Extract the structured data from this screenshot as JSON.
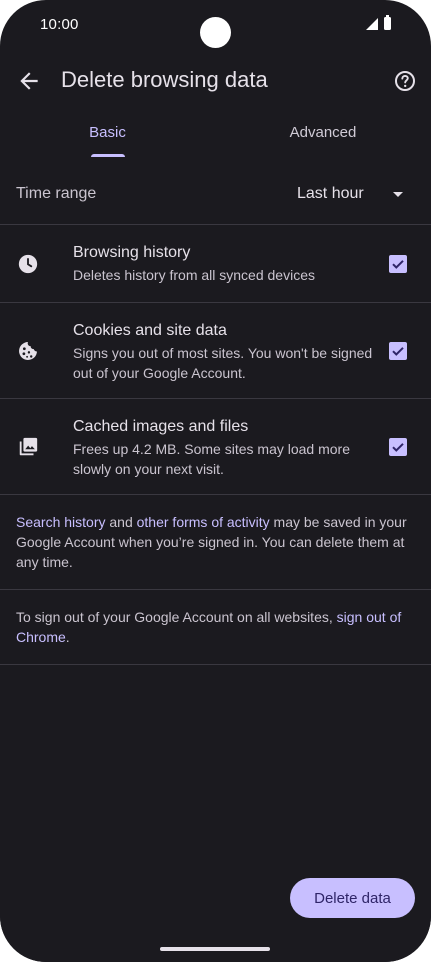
{
  "status_bar": {
    "time": "10:00"
  },
  "app_bar": {
    "title": "Delete browsing data"
  },
  "tabs": [
    {
      "label": "Basic",
      "selected": true
    },
    {
      "label": "Advanced",
      "selected": false
    }
  ],
  "time_range": {
    "label": "Time range",
    "value": "Last hour"
  },
  "items": [
    {
      "icon": "clock-icon",
      "title": "Browsing history",
      "subtitle": "Deletes history from all synced devices",
      "checked": true
    },
    {
      "icon": "cookie-icon",
      "title": "Cookies and site data",
      "subtitle": "Signs you out of most sites. You won't be signed out of your Google Account.",
      "checked": true
    },
    {
      "icon": "image-icon",
      "title": "Cached images and files",
      "subtitle": "Frees up 4.2 MB. Some sites may load more slowly on your next visit.",
      "checked": true
    }
  ],
  "info_activity": {
    "link1": "Search history",
    "text1": " and ",
    "link2": "other forms of activity",
    "text2": " may be saved in your Google Account when you’re signed in. You can delete them at any time."
  },
  "info_signout": {
    "text1": "To sign out of your Google Account on all websites, ",
    "link": "sign out of Chrome",
    "text2": "."
  },
  "actions": {
    "delete_label": "Delete data"
  },
  "colors": {
    "background": "#1b1a1f",
    "accent": "#c8bfff",
    "text": "#e6e1e9"
  }
}
